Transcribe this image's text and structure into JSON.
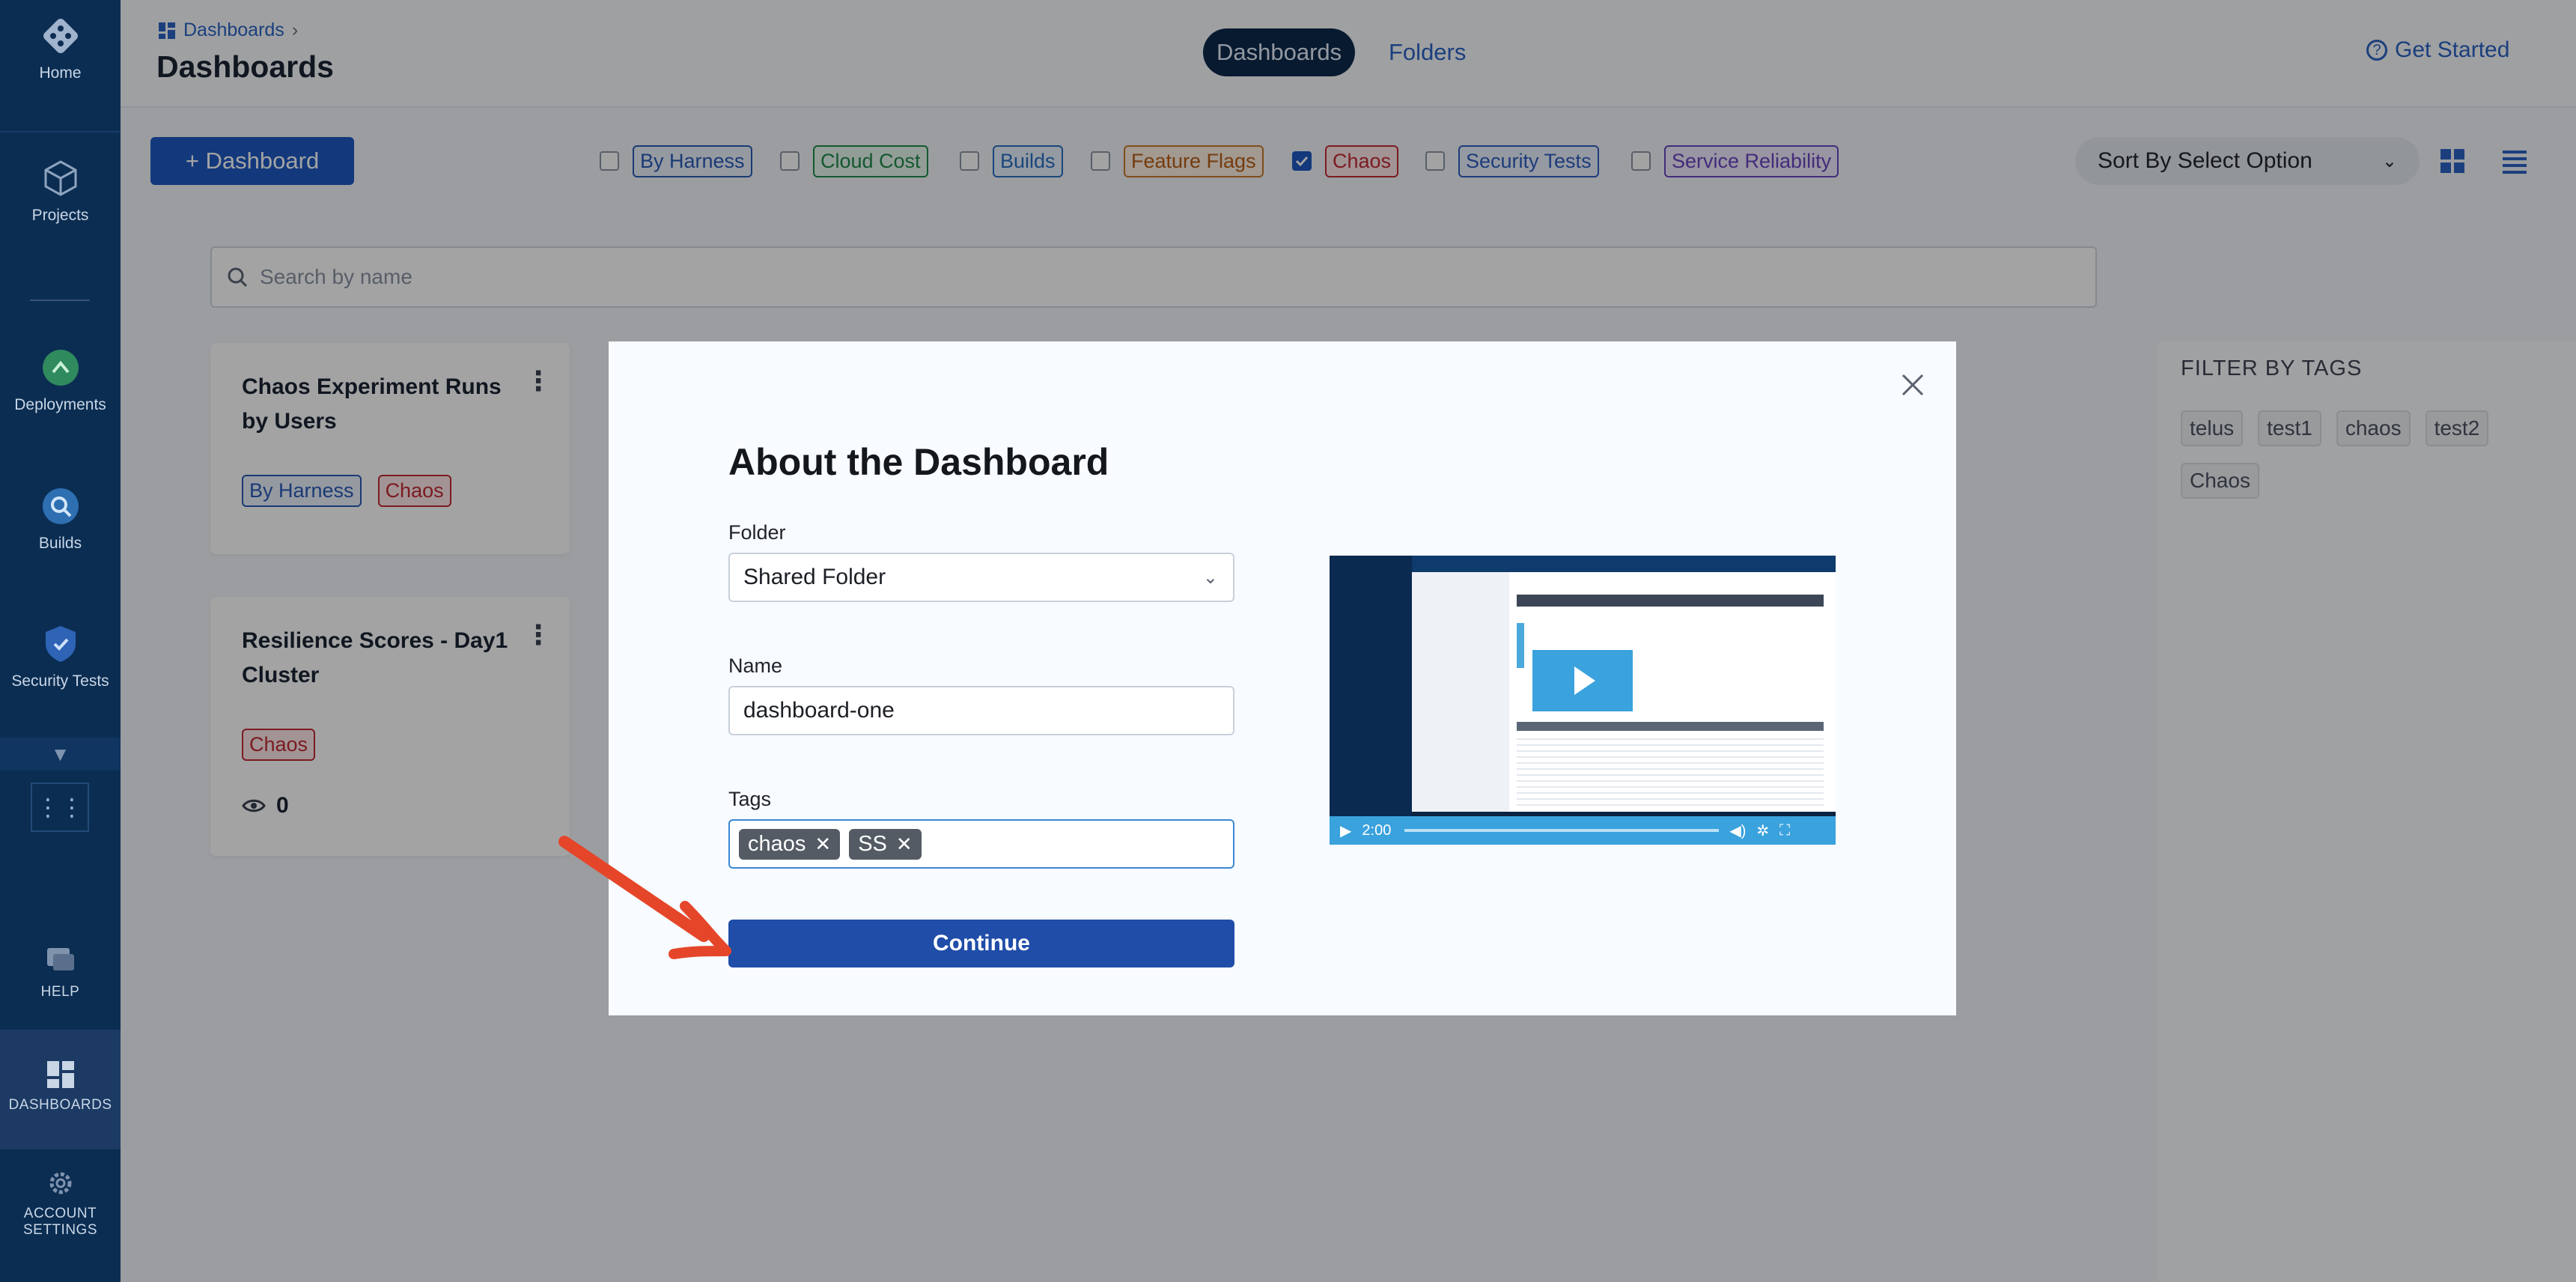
{
  "sidebar": {
    "items": [
      {
        "label": "Home"
      },
      {
        "label": "Projects"
      },
      {
        "label": "Deployments"
      },
      {
        "label": "Builds"
      },
      {
        "label": "Security Tests"
      },
      {
        "label": "HELP"
      },
      {
        "label": "DASHBOARDS"
      },
      {
        "label": "ACCOUNT SETTINGS"
      }
    ]
  },
  "header": {
    "breadcrumb": "Dashboards",
    "title": "Dashboards",
    "tabs": [
      {
        "label": "Dashboards"
      },
      {
        "label": "Folders"
      }
    ],
    "get_started": "Get Started"
  },
  "toolbar": {
    "add_button": "+ Dashboard",
    "filters": [
      {
        "label": "By Harness",
        "checked": false,
        "color": "#2a5bb8"
      },
      {
        "label": "Cloud Cost",
        "checked": false,
        "color": "#1f8a4c"
      },
      {
        "label": "Builds",
        "checked": false,
        "color": "#2a6fc4"
      },
      {
        "label": "Feature Flags",
        "checked": false,
        "color": "#b85f16"
      },
      {
        "label": "Chaos",
        "checked": true,
        "color": "#c32b35"
      },
      {
        "label": "Security Tests",
        "checked": false,
        "color": "#2f5fc0"
      },
      {
        "label": "Service Reliability",
        "checked": false,
        "color": "#6a45c0"
      }
    ],
    "sort_placeholder": "Sort By Select Option"
  },
  "search": {
    "placeholder": "Search by name"
  },
  "cards": [
    {
      "title": "Chaos Experiment Runs by Users",
      "tags": [
        "By Harness",
        "Chaos"
      ]
    },
    {
      "title": "Resilience Scores - Day1 Cluster",
      "tags": [
        "Chaos"
      ],
      "views": "0"
    }
  ],
  "filter_panel": {
    "title": "FILTER BY TAGS",
    "tags": [
      "telus",
      "test1",
      "chaos",
      "test2",
      "Chaos"
    ]
  },
  "modal": {
    "title": "About the Dashboard",
    "folder_label": "Folder",
    "folder_value": "Shared Folder",
    "name_label": "Name",
    "name_value": "dashboard-one",
    "tags_label": "Tags",
    "tags": [
      "chaos",
      "SS"
    ],
    "continue_label": "Continue",
    "video": {
      "time": "2:00"
    }
  }
}
